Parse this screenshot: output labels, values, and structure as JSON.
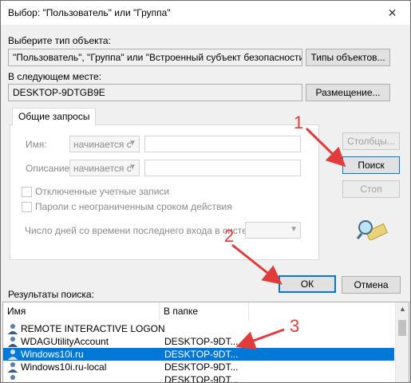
{
  "window": {
    "title": "Выбор: \"Пользователь\" или \"Группа\"",
    "close_glyph": "✕"
  },
  "object_type": {
    "label": "Выберите тип объекта:",
    "value": "\"Пользователь\", \"Группа\" или \"Встроенный субъект безопасности\"",
    "button": "Типы объектов..."
  },
  "location": {
    "label": "В следующем месте:",
    "value": "DESKTOP-9DTGB9E",
    "button": "Размещение..."
  },
  "queries": {
    "tab": "Общие запросы",
    "name_label": "Имя:",
    "name_combo": "начинается с",
    "desc_label": "Описание:",
    "desc_combo": "начинается с",
    "disabled_accounts": "Отключенные учетные записи",
    "no_expire_pw": "Пароли с неограниченным сроком действия",
    "days_label": "Число дней со времени последнего входа в систему:"
  },
  "buttons": {
    "columns": "Столбцы...",
    "search": "Поиск",
    "stop": "Стоп",
    "ok": "ОК",
    "cancel": "Отмена"
  },
  "results": {
    "label": "Результаты поиска:",
    "col_name": "Имя",
    "col_folder": "В папке",
    "rows": [
      {
        "name": "REMOTE INTERACTIVE LOGON",
        "folder": ""
      },
      {
        "name": "WDAGUtilityAccount",
        "folder": "DESKTOP-9DT..."
      },
      {
        "name": "Windows10i.ru",
        "folder": "DESKTOP-9DT..."
      },
      {
        "name": "Windows10i.ru-local",
        "folder": "DESKTOP-9DT..."
      },
      {
        "name": "",
        "folder": "DESKTOP-9DT..."
      }
    ]
  },
  "annotations": {
    "m1": "1",
    "m2": "2",
    "m3": "3"
  },
  "colors": {
    "accent": "#0078d7",
    "annotation": "#e23b3b"
  },
  "icons": {
    "user": "user-icon",
    "search_decor": "search-magnifier-icon"
  }
}
